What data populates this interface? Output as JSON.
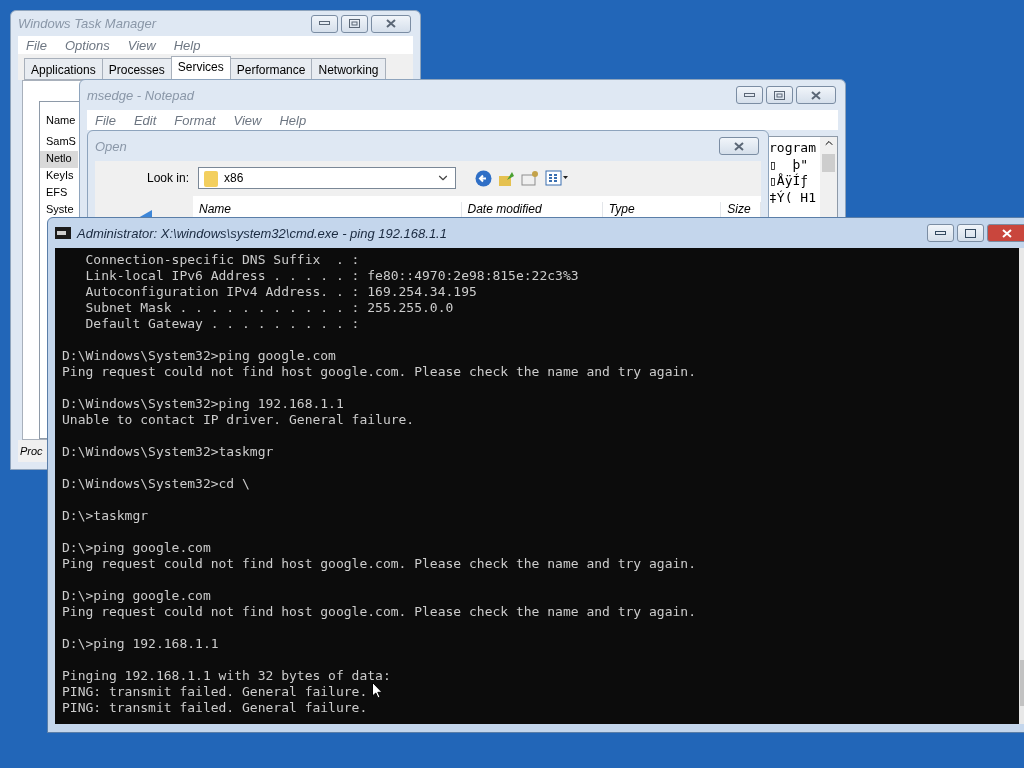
{
  "task_manager": {
    "title": "Windows Task Manager",
    "menu": [
      "File",
      "Options",
      "View",
      "Help"
    ],
    "tabs": [
      {
        "label": "Applications",
        "selected": false
      },
      {
        "label": "Processes",
        "selected": false
      },
      {
        "label": "Services",
        "selected": true
      },
      {
        "label": "Performance",
        "selected": false
      },
      {
        "label": "Networking",
        "selected": false
      }
    ],
    "column": "Name",
    "rows": [
      {
        "name": "SamS",
        "selected": false
      },
      {
        "name": "Netlo",
        "selected": true
      },
      {
        "name": "KeyIs",
        "selected": false
      },
      {
        "name": "EFS",
        "selected": false
      },
      {
        "name": "Syste",
        "selected": false
      }
    ],
    "status_bar": "Proc"
  },
  "notepad": {
    "title": "msedge - Notepad",
    "menu": [
      "File",
      "Edit",
      "Format",
      "View",
      "Help"
    ],
    "text_lines": [
      "rogram",
      "▯  þ\"",
      "▯ÅÿÍƒ",
      "‡Ý( H1"
    ]
  },
  "open_dialog": {
    "title": "Open",
    "look_in_label": "Look in:",
    "look_in_value": "x86",
    "columns": [
      "Name",
      "Date modified",
      "Type",
      "Size"
    ]
  },
  "console": {
    "title": "Administrator: X:\\windows\\system32\\cmd.exe - ping  192.168.1.1",
    "blocks": [
      [
        "   Connection-specific DNS Suffix  . :",
        "   Link-local IPv6 Address . . . . . : fe80::4970:2e98:815e:22c3%3",
        "   Autoconfiguration IPv4 Address. . : 169.254.34.195",
        "   Subnet Mask . . . . . . . . . . . : 255.255.0.0",
        "   Default Gateway . . . . . . . . . :"
      ],
      [
        "D:\\Windows\\System32>ping google.com",
        "Ping request could not find host google.com. Please check the name and try again."
      ],
      [
        "D:\\Windows\\System32>ping 192.168.1.1",
        "Unable to contact IP driver. General failure."
      ],
      [
        "D:\\Windows\\System32>taskmgr"
      ],
      [
        "D:\\Windows\\System32>cd \\"
      ],
      [
        "D:\\>taskmgr"
      ],
      [
        "D:\\>ping google.com",
        "Ping request could not find host google.com. Please check the name and try again."
      ],
      [
        "D:\\>ping google.com",
        "Ping request could not find host google.com. Please check the name and try again."
      ],
      [
        "D:\\>ping 192.168.1.1"
      ],
      [
        "Pinging 192.168.1.1 with 32 bytes of data:",
        "PING: transmit failed. General failure.",
        "PING: transmit failed. General failure."
      ]
    ]
  }
}
